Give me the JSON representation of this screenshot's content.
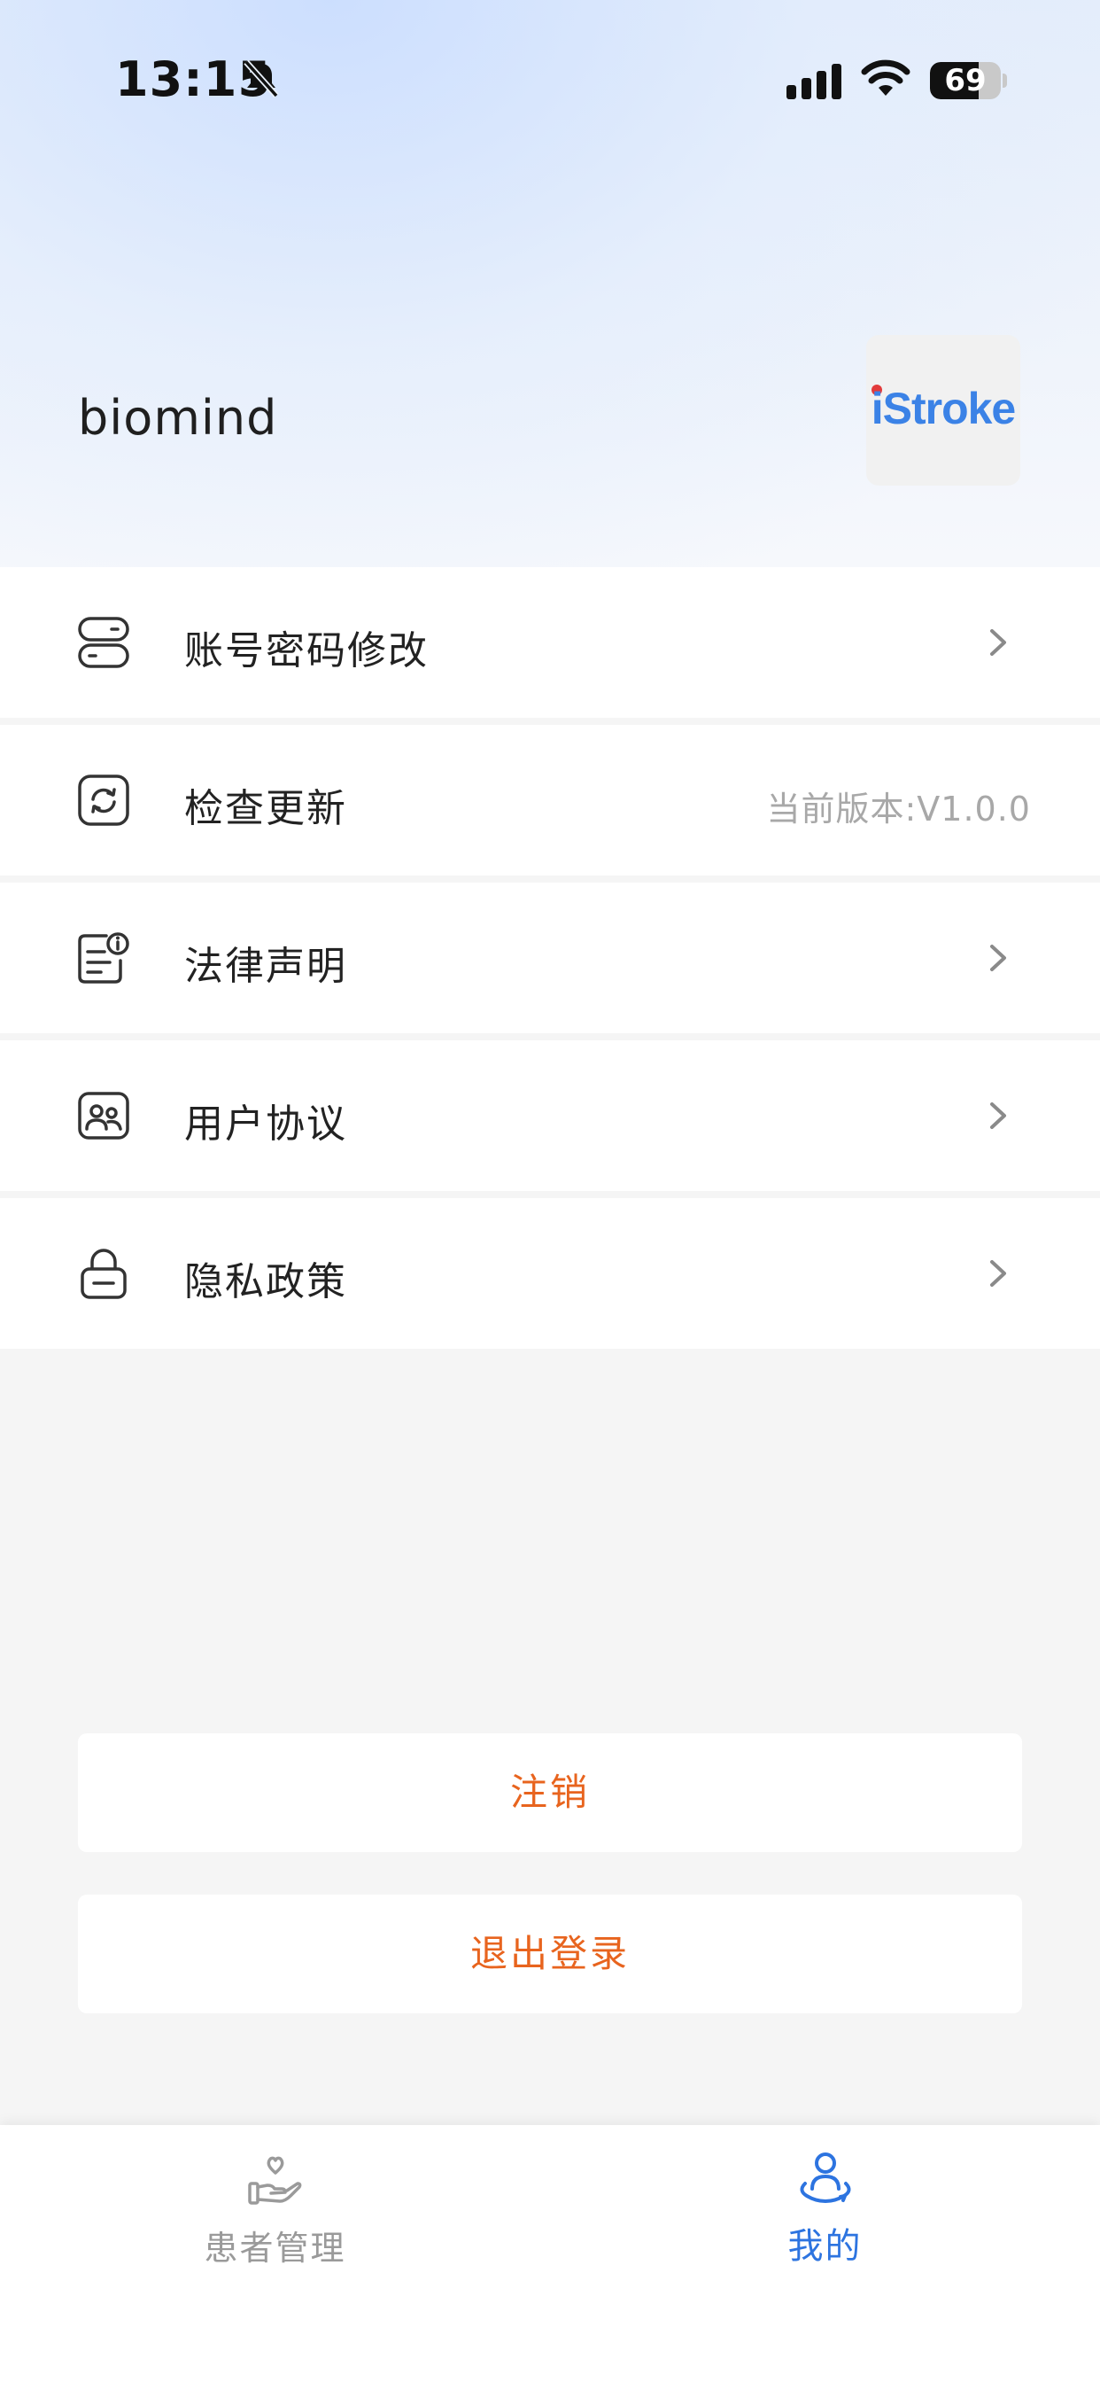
{
  "status_bar": {
    "time": "13:15",
    "battery_level": "69",
    "battery_fraction": 0.69
  },
  "profile": {
    "username": "biomind",
    "logo_text": "iStroke"
  },
  "menu": {
    "items": [
      {
        "label": "账号密码修改",
        "icon": "account-password-icon"
      },
      {
        "label": "检查更新",
        "icon": "update-icon",
        "value": "当前版本:V1.0.0"
      },
      {
        "label": "法律声明",
        "icon": "legal-document-icon"
      },
      {
        "label": "用户协议",
        "icon": "user-agreement-icon"
      },
      {
        "label": "隐私政策",
        "icon": "lock-icon"
      }
    ]
  },
  "actions": {
    "cancel_account_label": "注销",
    "logout_label": "退出登录"
  },
  "tab_bar": {
    "tabs": [
      {
        "label": "患者管理",
        "icon": "heart-hand-icon",
        "active": false
      },
      {
        "label": "我的",
        "icon": "user-profile-icon",
        "active": true
      }
    ]
  },
  "colors": {
    "accent_orange": "#e8641e",
    "active_blue": "#2d74e0",
    "logo_blue": "#3b82e6",
    "logo_red": "#e23b3b",
    "background": "#f5f5f5"
  }
}
